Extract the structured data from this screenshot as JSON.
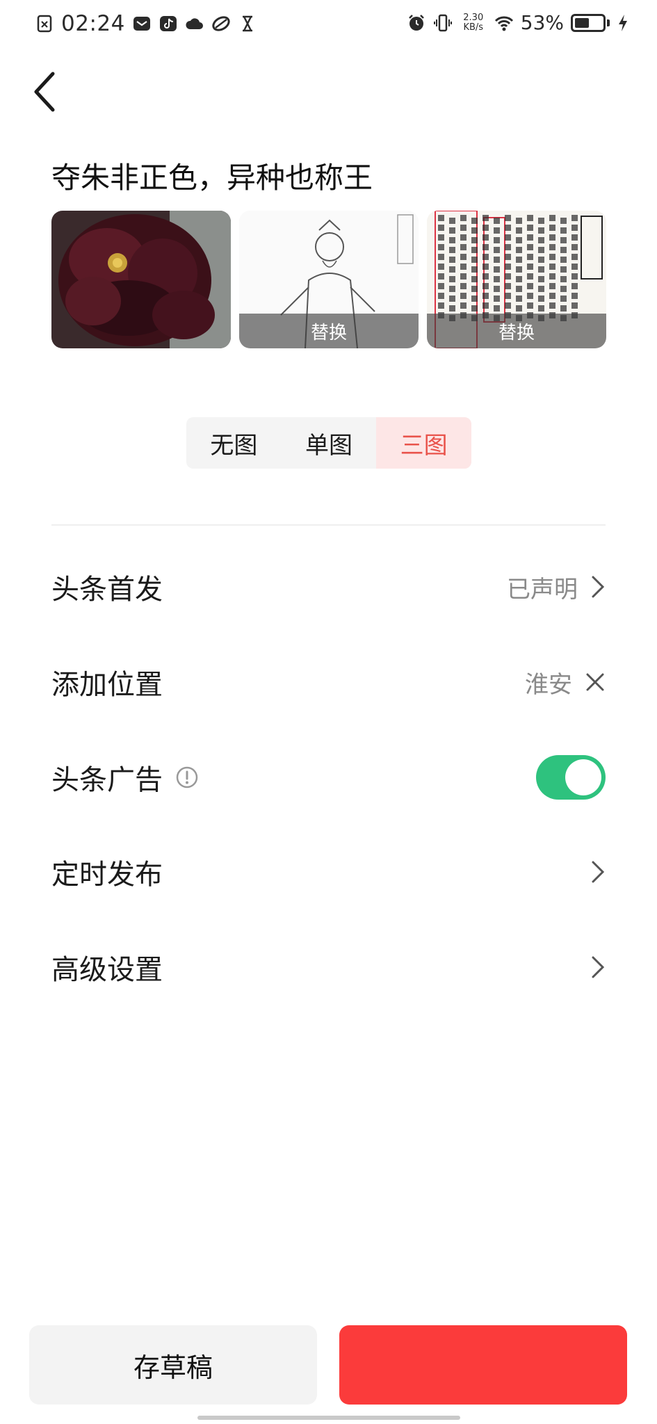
{
  "status_bar": {
    "time": "02:24",
    "net_speed_value": "2.30",
    "net_speed_unit": "KB/s",
    "battery_percent": "53%",
    "battery_level": 0.53,
    "icons_left": [
      "file-x-icon",
      "mail-icon",
      "tiktok-icon",
      "weather-cloud-icon",
      "app-icon",
      "hourglass-icon"
    ],
    "icons_right": [
      "alarm-icon",
      "vibrate-icon",
      "wifi-icon",
      "battery-icon",
      "charging-icon"
    ]
  },
  "header": {
    "back_icon": "chevron-left-icon"
  },
  "article": {
    "title": "夺朱非正色，异种也称王"
  },
  "thumbnails": [
    {
      "name": "thumb-dark-peony",
      "overlay_label": ""
    },
    {
      "name": "thumb-portrait-sketch",
      "overlay_label": "替换"
    },
    {
      "name": "thumb-old-text",
      "overlay_label": "替换"
    }
  ],
  "image_mode": {
    "options": [
      "无图",
      "单图",
      "三图"
    ],
    "selected": "三图"
  },
  "settings": {
    "first_publish": {
      "label": "头条首发",
      "value": "已声明"
    },
    "location": {
      "label": "添加位置",
      "value": "淮安"
    },
    "ads": {
      "label": "头条广告",
      "enabled": true
    },
    "schedule": {
      "label": "定时发布"
    },
    "advanced": {
      "label": "高级设置"
    }
  },
  "footer": {
    "draft_label": "存草稿",
    "publish_label": ""
  },
  "colors": {
    "accent_red": "#fb3b3b",
    "toggle_green": "#2ec27e",
    "segment_active_bg": "#fde6e6",
    "segment_active_text": "#e9534b"
  }
}
